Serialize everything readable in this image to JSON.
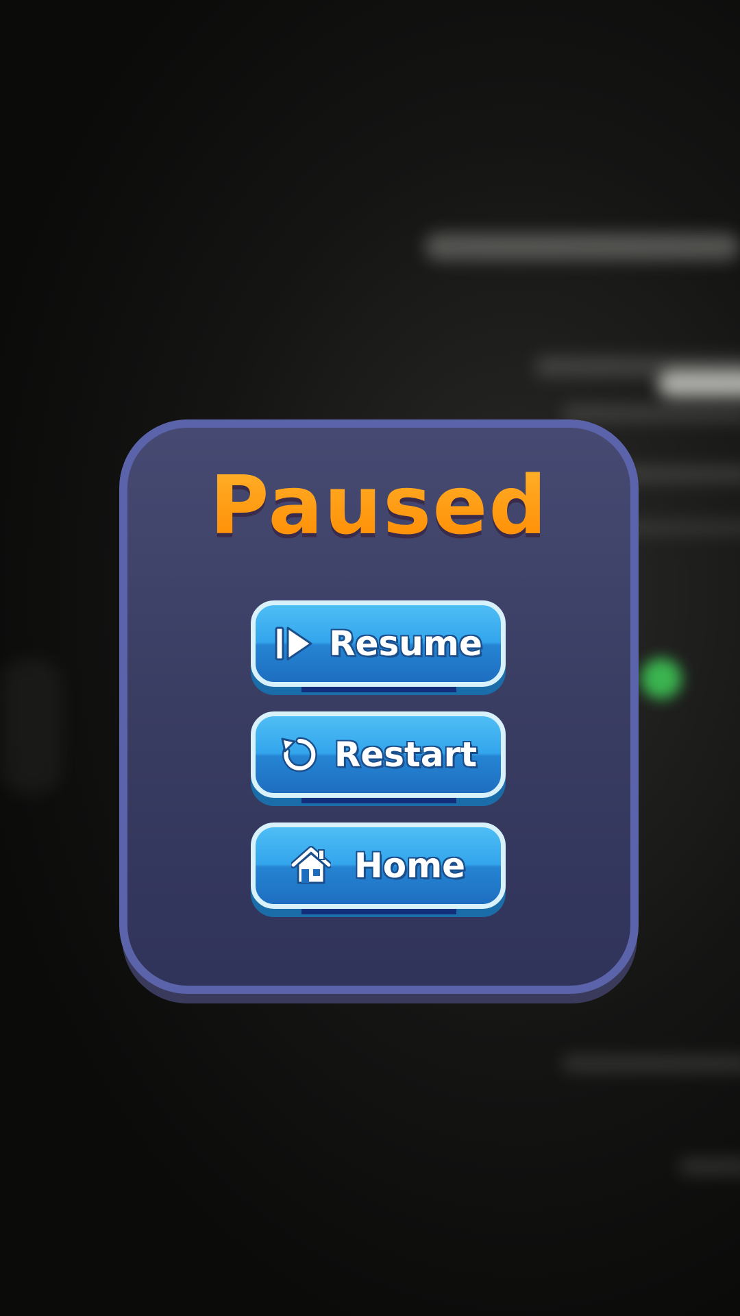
{
  "pause_menu": {
    "title": "Paused",
    "buttons": [
      {
        "label": "Resume",
        "icon": "play-icon"
      },
      {
        "label": "Restart",
        "icon": "restart-icon"
      },
      {
        "label": "Home",
        "icon": "home-icon"
      }
    ]
  },
  "colors": {
    "title": "#ff9a10",
    "panel_border": "#5b63ab",
    "panel_fill": "#3a3d62",
    "button_fill": "#33a5ec",
    "button_border": "#d8f1fb"
  }
}
